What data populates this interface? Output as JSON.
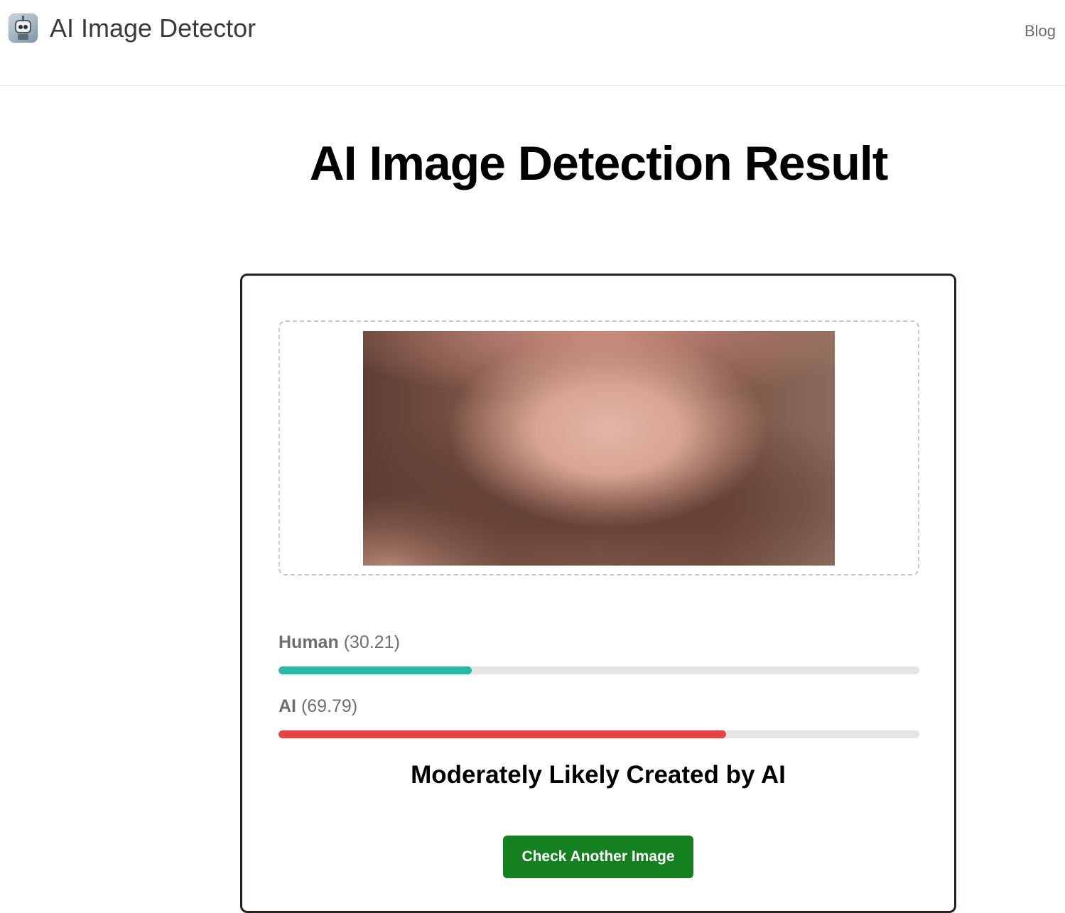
{
  "header": {
    "brand_name": "AI Image Detector",
    "logo_icon": "robot-icon",
    "nav": {
      "blog_label": "Blog"
    }
  },
  "main": {
    "title": "AI Image Detection Result",
    "result": {
      "preview_image": "uploaded-image-preview",
      "scores": [
        {
          "label": "Human",
          "value": "(30.21)",
          "percent": 30.21,
          "color": "#2bb8a6"
        },
        {
          "label": "AI",
          "value": "(69.79)",
          "percent": 69.79,
          "color": "#e84343"
        }
      ],
      "verdict": "Moderately Likely Created by AI",
      "cta_label": "Check Another Image"
    }
  },
  "colors": {
    "accent_green": "#15801f",
    "card_border": "#2a1f1c"
  }
}
